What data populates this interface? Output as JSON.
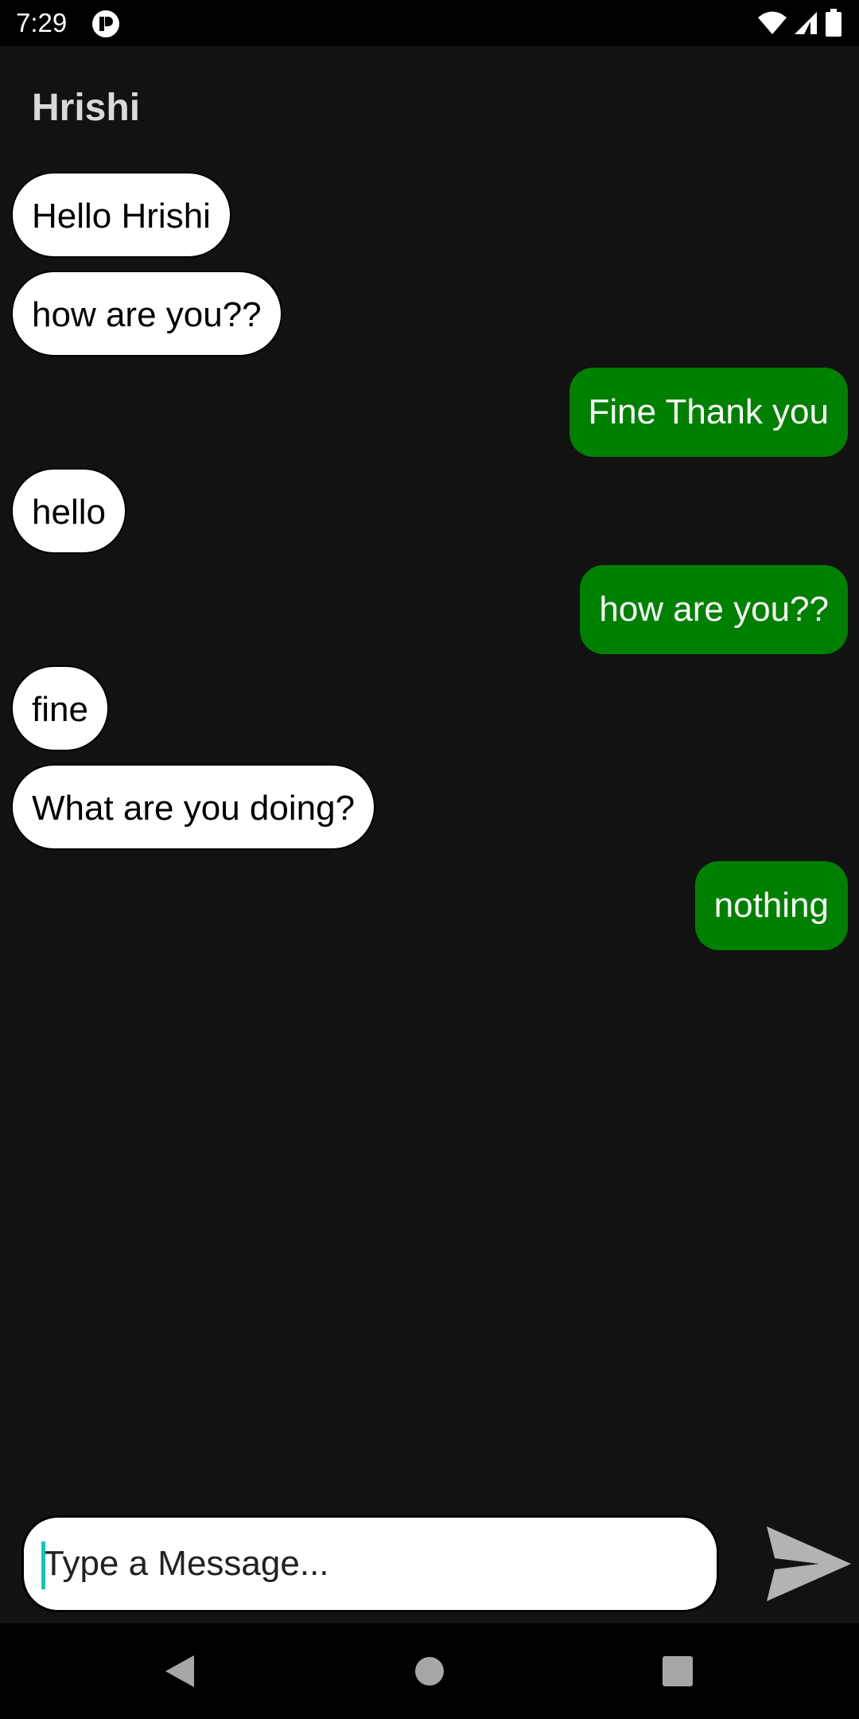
{
  "status_bar": {
    "time": "7:29",
    "icons": [
      "app-notification-icon",
      "wifi-icon",
      "signal-icon",
      "battery-icon"
    ]
  },
  "header": {
    "title": "Hrishi"
  },
  "messages": [
    {
      "direction": "incoming",
      "text": "Hello Hrishi"
    },
    {
      "direction": "incoming",
      "text": "how are you??"
    },
    {
      "direction": "outgoing",
      "text": "Fine Thank you"
    },
    {
      "direction": "incoming",
      "text": "hello"
    },
    {
      "direction": "outgoing",
      "text": "how are you??"
    },
    {
      "direction": "incoming",
      "text": "fine"
    },
    {
      "direction": "incoming",
      "text": "What are you doing?"
    },
    {
      "direction": "outgoing",
      "text": "nothing"
    }
  ],
  "composer": {
    "placeholder": "Type a Message...",
    "value": "",
    "send_icon": "send-icon"
  },
  "nav_bar": {
    "buttons": [
      "back-icon",
      "home-icon",
      "recents-icon"
    ]
  },
  "colors": {
    "background": "#121212",
    "outgoing_bubble": "#008000",
    "incoming_bubble": "#ffffff",
    "caret": "#12c6b8"
  }
}
